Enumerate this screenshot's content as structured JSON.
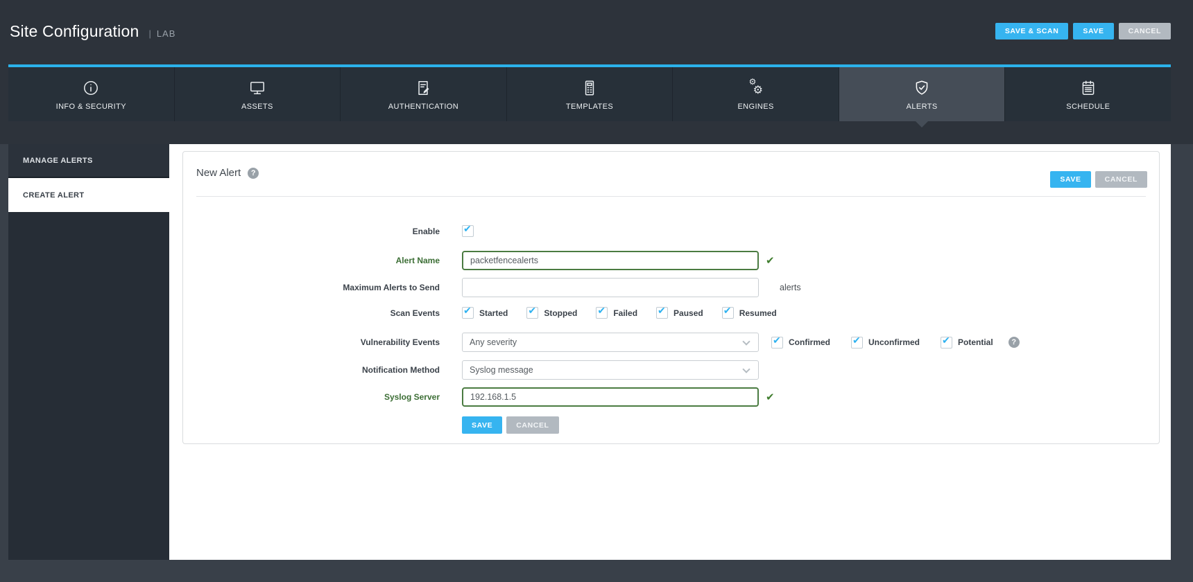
{
  "header": {
    "title": "Site Configuration",
    "separator": "|",
    "site_name": "LAB",
    "buttons": {
      "save_scan": "SAVE & SCAN",
      "save": "SAVE",
      "cancel": "CANCEL"
    }
  },
  "tabs": [
    {
      "label": "INFO & SECURITY",
      "icon": "info-icon",
      "active": false
    },
    {
      "label": "ASSETS",
      "icon": "monitor-icon",
      "active": false
    },
    {
      "label": "AUTHENTICATION",
      "icon": "document-edit-icon",
      "active": false
    },
    {
      "label": "TEMPLATES",
      "icon": "template-icon",
      "active": false
    },
    {
      "label": "ENGINES",
      "icon": "gears-icon",
      "active": false
    },
    {
      "label": "ALERTS",
      "icon": "shield-check-icon",
      "active": true
    },
    {
      "label": "SCHEDULE",
      "icon": "calendar-icon",
      "active": false
    }
  ],
  "sidebar": {
    "items": [
      {
        "label": "MANAGE ALERTS",
        "active": false
      },
      {
        "label": "CREATE ALERT",
        "active": true
      }
    ]
  },
  "panel": {
    "title": "New Alert",
    "buttons": {
      "save": "SAVE",
      "cancel": "CANCEL"
    },
    "form": {
      "enable": {
        "label": "Enable",
        "checked": true
      },
      "alert_name": {
        "label": "Alert Name",
        "value": "packetfencealerts",
        "valid": true
      },
      "max_alerts": {
        "label": "Maximum Alerts to Send",
        "value": "",
        "unit": "alerts"
      },
      "scan_events": {
        "label": "Scan Events",
        "options": [
          {
            "label": "Started",
            "checked": true
          },
          {
            "label": "Stopped",
            "checked": true
          },
          {
            "label": "Failed",
            "checked": true
          },
          {
            "label": "Paused",
            "checked": true
          },
          {
            "label": "Resumed",
            "checked": true
          }
        ]
      },
      "vulnerability_events": {
        "label": "Vulnerability Events",
        "severity_value": "Any severity",
        "options": [
          {
            "label": "Confirmed",
            "checked": true
          },
          {
            "label": "Unconfirmed",
            "checked": true
          },
          {
            "label": "Potential",
            "checked": true
          }
        ]
      },
      "notification_method": {
        "label": "Notification Method",
        "value": "Syslog message"
      },
      "syslog_server": {
        "label": "Syslog Server",
        "value": "192.168.1.5",
        "valid": true
      },
      "buttons": {
        "save": "SAVE",
        "cancel": "CANCEL"
      }
    }
  },
  "colors": {
    "header_bg": "#2d333b",
    "body_bg": "#394049",
    "tab_bg": "#273039",
    "tab_active_bg": "#454d57",
    "accent_cyan": "#2bb2ea",
    "accent_blue": "#36b4f0",
    "button_gray": "#b2b9c0",
    "valid_green": "#4a7b41",
    "check_blue": "#2fb2f0"
  }
}
